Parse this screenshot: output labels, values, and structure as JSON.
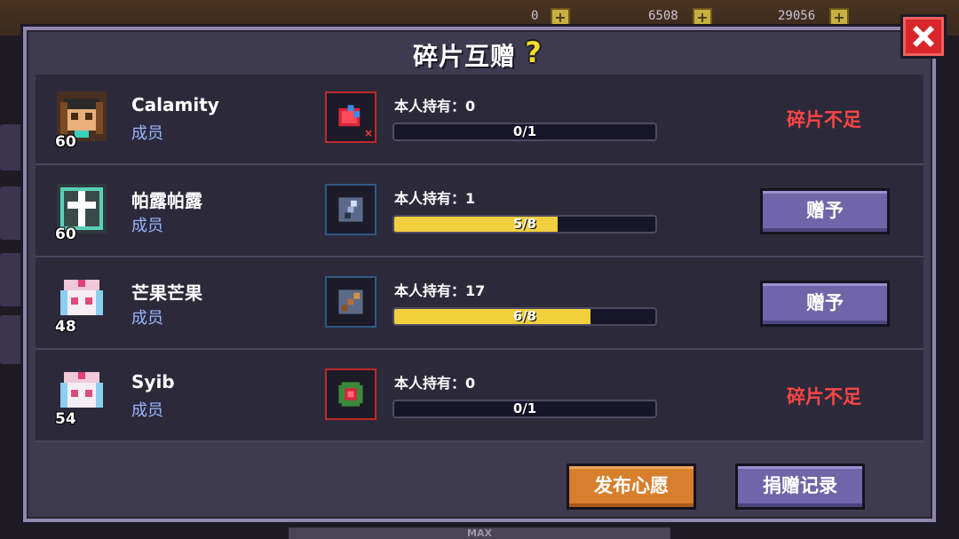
{
  "hud": {
    "stat_1": "0",
    "stat_2": "6508",
    "stat_3": "29056",
    "max_label": "MAX"
  },
  "dialog": {
    "title": "碎片互赠",
    "help_icon": "question-mark-icon",
    "close_icon": "close-x-icon"
  },
  "members": [
    {
      "name": "Calamity",
      "role": "成员",
      "level": "60",
      "owned_label": "本人持有：0",
      "progress_text": "0/1",
      "progress": 0.0,
      "item_icon": "red-gem-shard-icon",
      "action_text": "碎片不足",
      "action_type": "insufficient"
    },
    {
      "name": "帕露帕露",
      "role": "成员",
      "level": "60",
      "owned_label": "本人持有：1",
      "progress_text": "5/8",
      "progress": 0.625,
      "item_icon": "spear-shard-icon",
      "action_text": "赠予",
      "action_type": "button"
    },
    {
      "name": "芒果芒果",
      "role": "成员",
      "level": "48",
      "owned_label": "本人持有：17",
      "progress_text": "6/8",
      "progress": 0.75,
      "item_icon": "staff-shard-icon",
      "action_text": "赠予",
      "action_type": "button"
    },
    {
      "name": "Syib",
      "role": "成员",
      "level": "54",
      "owned_label": "本人持有：0",
      "progress_text": "0/1",
      "progress": 0.0,
      "item_icon": "ruby-ring-icon",
      "action_text": "碎片不足",
      "action_type": "insufficient"
    }
  ],
  "footer": {
    "publish_wish": "发布心愿",
    "donation_log": "捐赠记录"
  },
  "colors": {
    "accent_yellow": "#f2cf3c",
    "warning_red": "#ff4545",
    "button_purple": "#6f65a8",
    "button_orange": "#d77f2c",
    "role_blue": "#9bb4ff"
  }
}
